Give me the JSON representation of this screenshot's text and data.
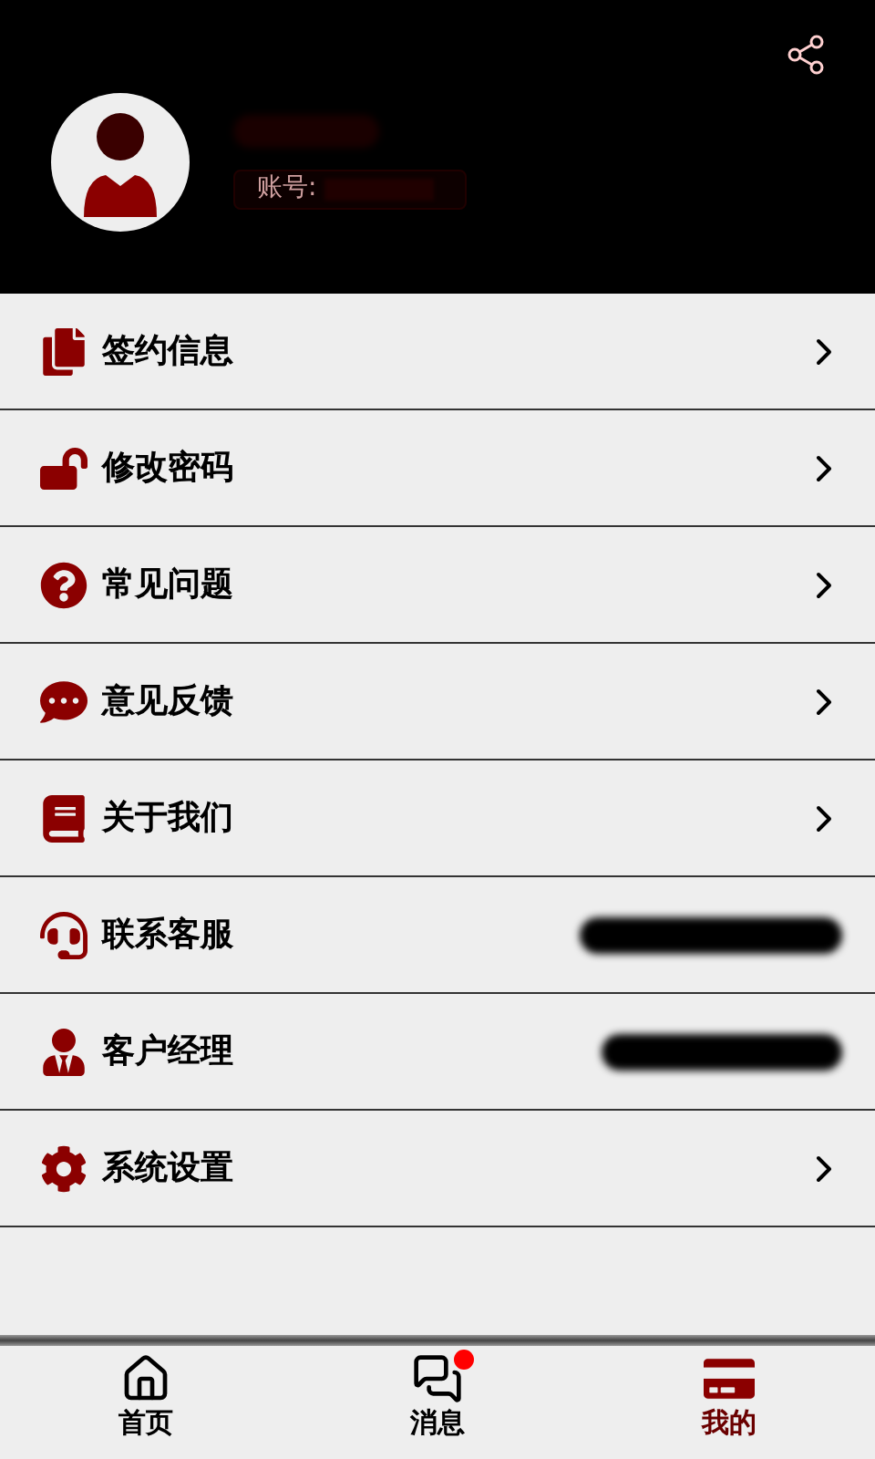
{
  "profile": {
    "account_label": "账号:"
  },
  "menu": [
    {
      "label": "签约信息",
      "kind": "link"
    },
    {
      "label": "修改密码",
      "kind": "link"
    },
    {
      "label": "常见问题",
      "kind": "link"
    },
    {
      "label": "意见反馈",
      "kind": "link"
    },
    {
      "label": "关于我们",
      "kind": "link"
    },
    {
      "label": "联系客服",
      "kind": "redacted"
    },
    {
      "label": "客户经理",
      "kind": "redacted"
    },
    {
      "label": "系统设置",
      "kind": "link"
    }
  ],
  "tabs": [
    {
      "label": "首页",
      "selected": false,
      "badge": false
    },
    {
      "label": "消息",
      "selected": false,
      "badge": true
    },
    {
      "label": "我的",
      "selected": true,
      "badge": false
    }
  ]
}
